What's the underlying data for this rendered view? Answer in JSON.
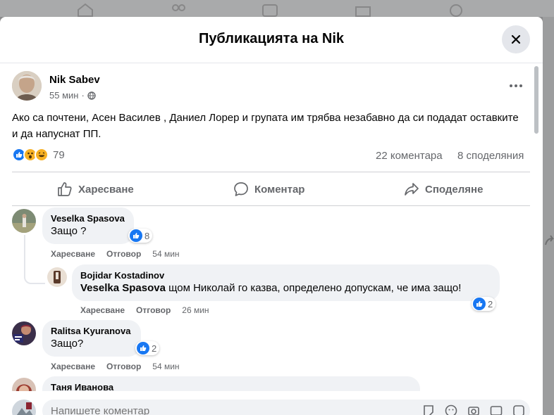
{
  "modal": {
    "title": "Публикацията на Nik"
  },
  "post": {
    "author": "Nik Sabev",
    "time": "55 мин",
    "separator": "·",
    "text": "Ако са почтени, Асен Василев , Даниел Лорер и групата им трябва незабавно да си подадат оставките и да напуснат ПП.",
    "reaction_count": "79",
    "comments": "22 коментара",
    "shares": "8 споделяния"
  },
  "actions": {
    "like": "Харесване",
    "comment": "Коментар",
    "share": "Споделяне"
  },
  "comments": [
    {
      "name": "Veselka Spasova",
      "text": "Защо ?",
      "likes": "8",
      "like_label": "Харесване",
      "reply_label": "Отговор",
      "time": "54 мин"
    },
    {
      "name": "Bojidar Kostadinov",
      "mention": "Veselka Spasova",
      "text": " щом Николай го казва, определено допускам, че има защо!",
      "likes": "2",
      "like_label": "Харесване",
      "reply_label": "Отговор",
      "time": "26 мин"
    },
    {
      "name": "Ralitsa Kyuranova",
      "text": "Защо?",
      "likes": "2",
      "like_label": "Харесване",
      "reply_label": "Отговор",
      "time": "54 мин"
    },
    {
      "name": "Таня Иванова"
    }
  ],
  "composer": {
    "placeholder": "Напишете коментар"
  },
  "colors": {
    "accent": "#1877f2",
    "bubble": "#f0f2f5",
    "muted": "#65676b"
  },
  "icons": [
    "home-icon",
    "friends-icon",
    "video-icon",
    "marketplace-icon",
    "groups-icon",
    "close-icon",
    "globe-icon",
    "more-icon",
    "like-icon",
    "comment-icon",
    "share-icon",
    "sticker-icon",
    "emoji-icon",
    "camera-icon",
    "gif-icon"
  ]
}
